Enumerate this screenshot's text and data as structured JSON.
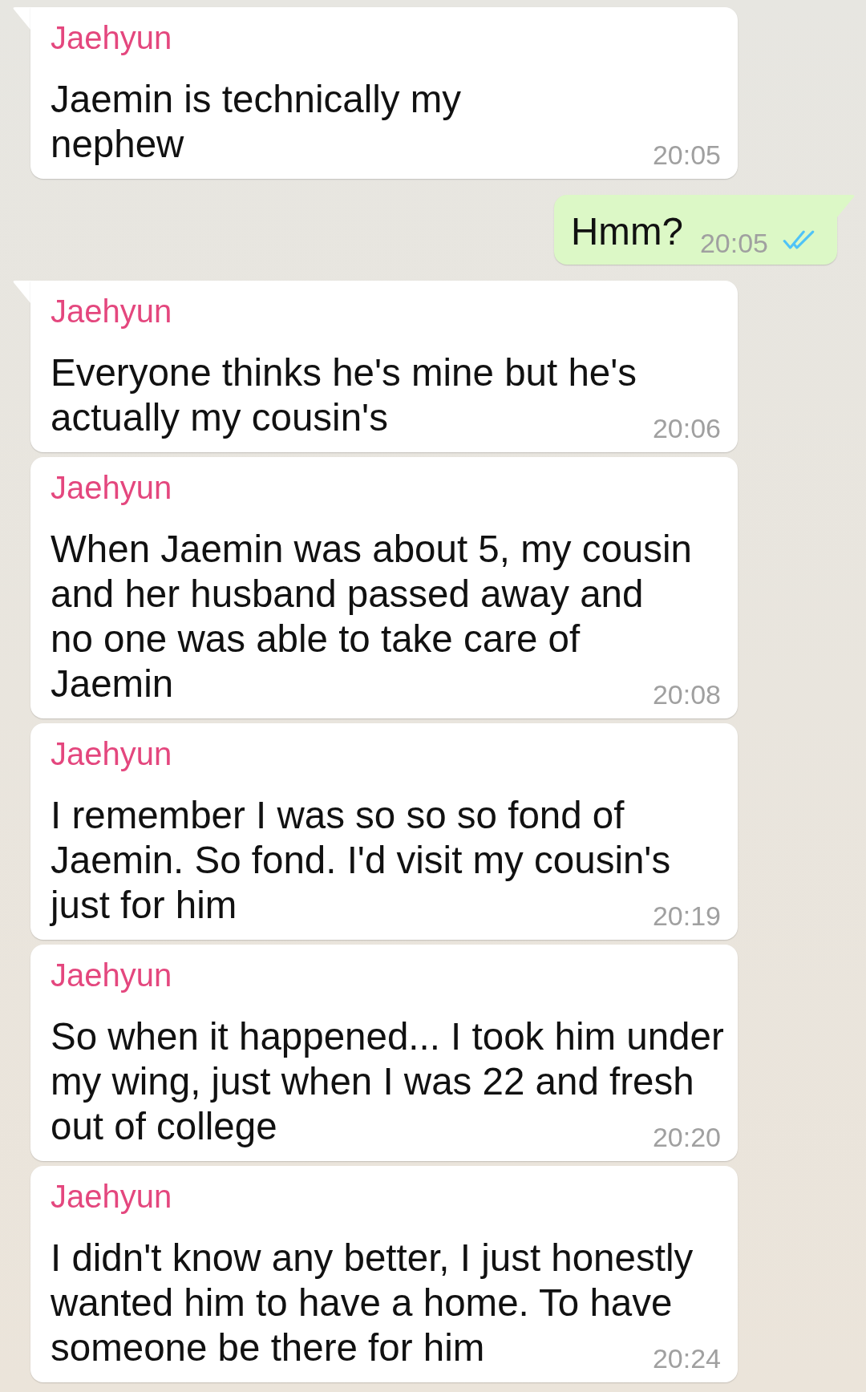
{
  "messages": [
    {
      "kind": "received",
      "tail": true,
      "sender": "Jaehyun",
      "text": "Jaemin is technically my\nnephew",
      "time": "20:05"
    },
    {
      "kind": "sent",
      "tail": true,
      "text": "Hmm?",
      "time": "20:05",
      "read": true
    },
    {
      "kind": "received",
      "tail": true,
      "sender": "Jaehyun",
      "text": "Everyone thinks he's mine but he's\nactually my cousin's",
      "time": "20:06"
    },
    {
      "kind": "received",
      "tail": false,
      "sender": "Jaehyun",
      "text": "When Jaemin was about 5, my cousin\nand her husband passed away and\nno one was able to take care of\nJaemin",
      "time": "20:08"
    },
    {
      "kind": "received",
      "tail": false,
      "sender": "Jaehyun",
      "text": "I remember I was so so so fond of\nJaemin. So fond. I'd visit my cousin's\njust for him",
      "time": "20:19"
    },
    {
      "kind": "received",
      "tail": false,
      "sender": "Jaehyun",
      "text": "So when it happened... I took him under\nmy wing, just when I was 22 and fresh\nout of college",
      "time": "20:20"
    },
    {
      "kind": "received",
      "tail": false,
      "sender": "Jaehyun",
      "text": "I didn't know any better, I just honestly\nwanted him to have a home. To have\nsomeone be there for him",
      "time": "20:24"
    }
  ]
}
